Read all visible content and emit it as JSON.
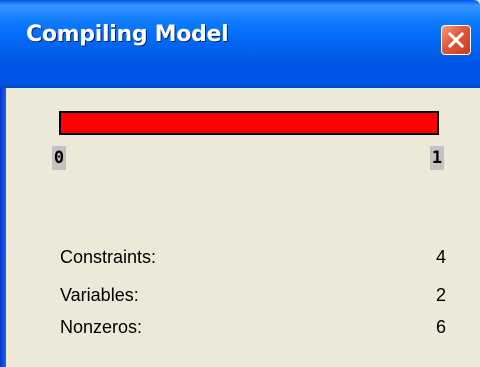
{
  "window": {
    "title": "Compiling Model"
  },
  "progress": {
    "value": 1.0,
    "min_label": "0",
    "max_label": "1",
    "fill_color": "#ff0000"
  },
  "stats": [
    {
      "label": "Constraints:",
      "value": "4"
    },
    {
      "label": "Variables:",
      "value": "2"
    },
    {
      "label": "Nonzeros:",
      "value": "6"
    }
  ],
  "icons": {
    "close": "close-icon"
  },
  "colors": {
    "titlebar": "#0054e3",
    "dialog_bg": "#ece9d8",
    "close_button": "#e2583c"
  }
}
